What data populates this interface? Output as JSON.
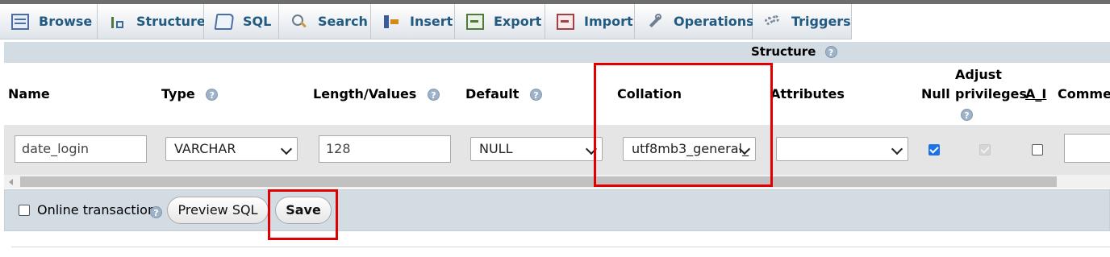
{
  "tabs": [
    {
      "label": "Browse",
      "icon": "browse-icon"
    },
    {
      "label": "Structure",
      "icon": "structure-icon"
    },
    {
      "label": "SQL",
      "icon": "sql-icon"
    },
    {
      "label": "Search",
      "icon": "search-icon"
    },
    {
      "label": "Insert",
      "icon": "insert-icon"
    },
    {
      "label": "Export",
      "icon": "export-icon"
    },
    {
      "label": "Import",
      "icon": "import-icon"
    },
    {
      "label": "Operations",
      "icon": "operations-icon"
    },
    {
      "label": "Triggers",
      "icon": "triggers-icon"
    }
  ],
  "structure_title": "Structure",
  "headers": {
    "name": "Name",
    "type": "Type",
    "length": "Length/Values",
    "default": "Default",
    "collation": "Collation",
    "attributes": "Attributes",
    "null": "Null",
    "adjust_line1": "Adjust",
    "adjust_line2": "privileges",
    "ai": "A_I",
    "comments": "Commer"
  },
  "row": {
    "name": "date_login",
    "type": "VARCHAR",
    "length": "128",
    "default": "NULL",
    "collation": "utf8mb3_general_",
    "attributes": "",
    "null_checked": true,
    "adjust_privileges_checked": true,
    "adjust_privileges_disabled": true,
    "ai_checked": false,
    "comments": ""
  },
  "footer": {
    "online_transaction_label": "Online transaction",
    "online_transaction_checked": false,
    "preview_sql_label": "Preview SQL",
    "save_label": "Save"
  },
  "colors": {
    "tab_text": "#235a81",
    "structure_bar": "#d3dce3",
    "row_bg": "#e5e5e5",
    "highlight": "#e00000",
    "checkbox_checked": "#1a73e8"
  }
}
